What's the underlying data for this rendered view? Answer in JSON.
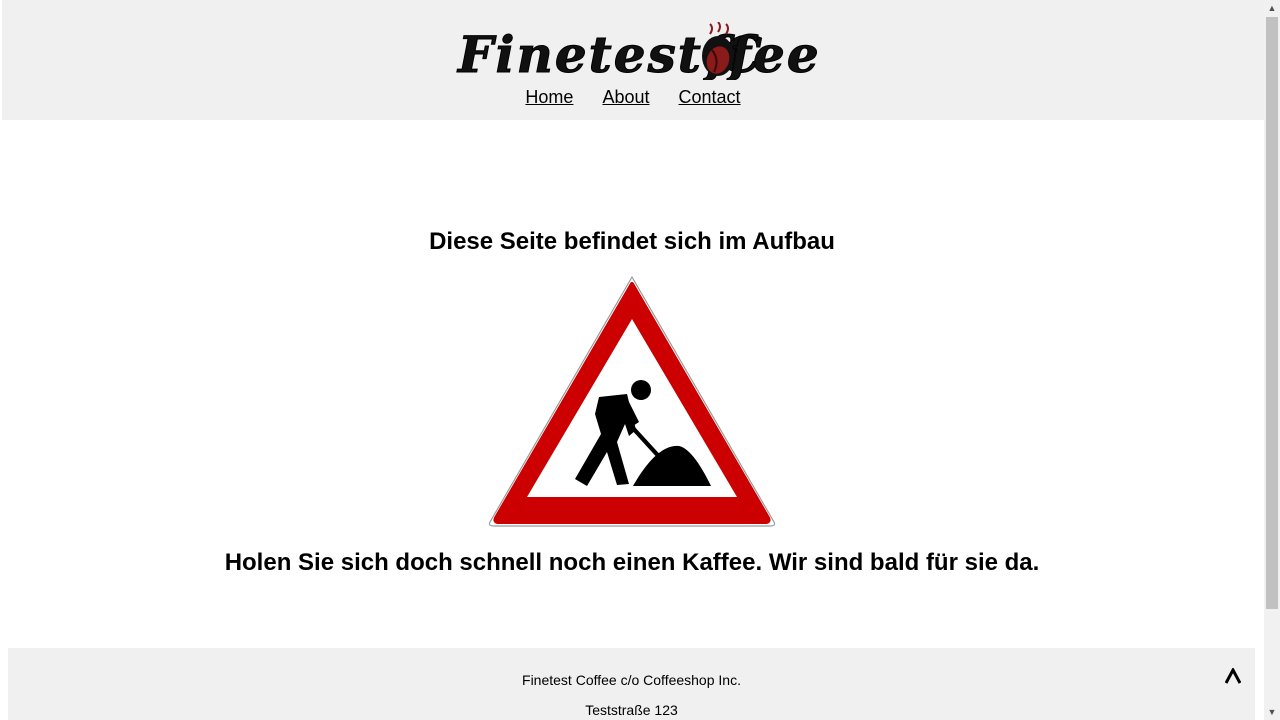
{
  "header": {
    "logo_text_1": "Finetest C",
    "logo_text_2": "ffee",
    "nav": [
      {
        "label": "Home"
      },
      {
        "label": "About"
      },
      {
        "label": "Contact"
      }
    ]
  },
  "main": {
    "heading": "Diese Seite befindet sich im Aufbau",
    "sign_icon": "road-works-sign",
    "subheading": "Holen Sie sich doch schnell noch einen Kaffee. Wir sind bald für sie da."
  },
  "footer": {
    "company": "Finetest Coffee c/o Coffeeshop Inc.",
    "street": "Teststraße 123",
    "back_to_top": "^"
  },
  "colors": {
    "header_bg": "#f0f0f0",
    "sign_red": "#cc0000",
    "coffee_bean": "#8b1a1a"
  }
}
